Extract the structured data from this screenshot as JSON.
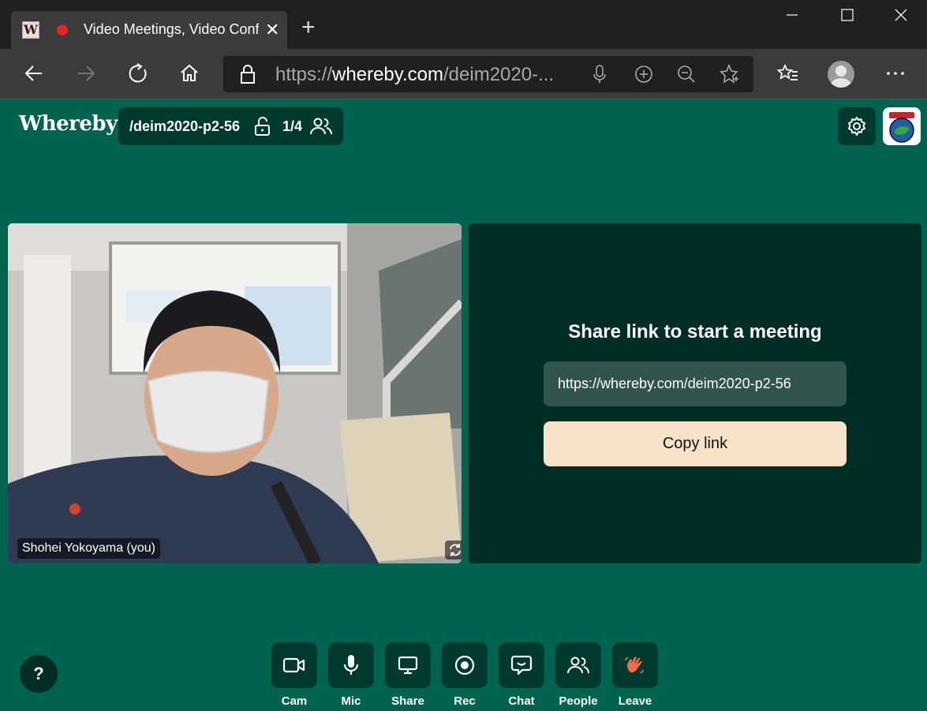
{
  "browser": {
    "tab_title": "Video Meetings, Video Conf",
    "favicon_letter": "W",
    "url_scheme": "https://",
    "url_host": "whereby.com",
    "url_path": "/deim2020-..."
  },
  "app": {
    "logo": "Whereby",
    "room_name": "/deim2020-p2-56",
    "participant_count": "1/4"
  },
  "video": {
    "participant_name": "Shohei Yokoyama (you)"
  },
  "share": {
    "title": "Share link to start a meeting",
    "link": "https://whereby.com/deim2020-p2-56",
    "copy_label": "Copy link"
  },
  "help_label": "?",
  "controls": [
    {
      "label": "Cam",
      "icon": "camera-icon"
    },
    {
      "label": "Mic",
      "icon": "microphone-icon"
    },
    {
      "label": "Share",
      "icon": "screen-share-icon"
    },
    {
      "label": "Rec",
      "icon": "record-icon"
    },
    {
      "label": "Chat",
      "icon": "chat-icon"
    },
    {
      "label": "People",
      "icon": "people-icon"
    },
    {
      "label": "Leave",
      "icon": "wave-hand-icon"
    }
  ],
  "colors": {
    "background": "#00634f",
    "panel": "#002d24",
    "button": "#003a2e",
    "copy_button": "#f8e2c8",
    "leave_icon": "#f26b4b"
  }
}
